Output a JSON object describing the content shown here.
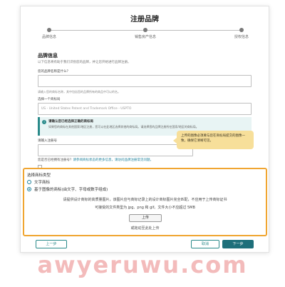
{
  "header": {
    "title": "注册品牌"
  },
  "stepper": {
    "steps": [
      "品牌信息",
      "销售房产信息",
      "授权信息"
    ]
  },
  "section": {
    "title": "品牌信息",
    "desc": "以下信息将有助于我们识别您的品牌，并让您开始进行品牌注册。"
  },
  "fields": {
    "brand_name_label": "您的品牌名称是什么？",
    "brand_name_hint": "请输入您的商标名称，其中包括您的品牌所有的商品中可以的名。",
    "trademark_office_label": "选择一个商标局",
    "trademark_office_value": "US - United States Patent and Trademark Office - USPTO",
    "registration_label": "请输入注册号"
  },
  "notice": {
    "icon": "info-icon",
    "title": "请确认您已经选择正确的商标局",
    "body": "如果您的商标在其他国家/地区注册，您可以在此地区选择其他的商标局。请选择您的品牌注册所在国家/地区的商标局。"
  },
  "tooltip": {
    "text": "上传的图像必须要与您在商标局提交的图像一致，确保它清晰可见。"
  },
  "link_line": {
    "prefix": "您是否已经拥有注册号？",
    "link": "请参阅商标状态的更多信息，请访问品牌注册常见问题。"
  },
  "upload": {
    "title": "选择商标类型",
    "options": [
      "文字商标",
      "基于图像的商标(由文字、字母或数字组成)"
    ],
    "selected_index": 1,
    "desc": "请提供设计商标的高质量图片，该图片应与商标记录上的设计商标图片完全匹配，不应用于上传商标证书",
    "formats": "可接受的文件类型为 jpg、png 和 gif。文件大小不应超过 5MB",
    "upload_label": "上传",
    "drag_text": "或拖动至此处上传"
  },
  "footer": {
    "prev_label": "上一步",
    "cancel_label": "取消",
    "next_label": "下一步"
  },
  "watermark": "awyeruwu.com",
  "colors": {
    "accent": "#1e6f7a",
    "highlight_border": "#f0a531",
    "tooltip_bg": "#f7df9a"
  }
}
